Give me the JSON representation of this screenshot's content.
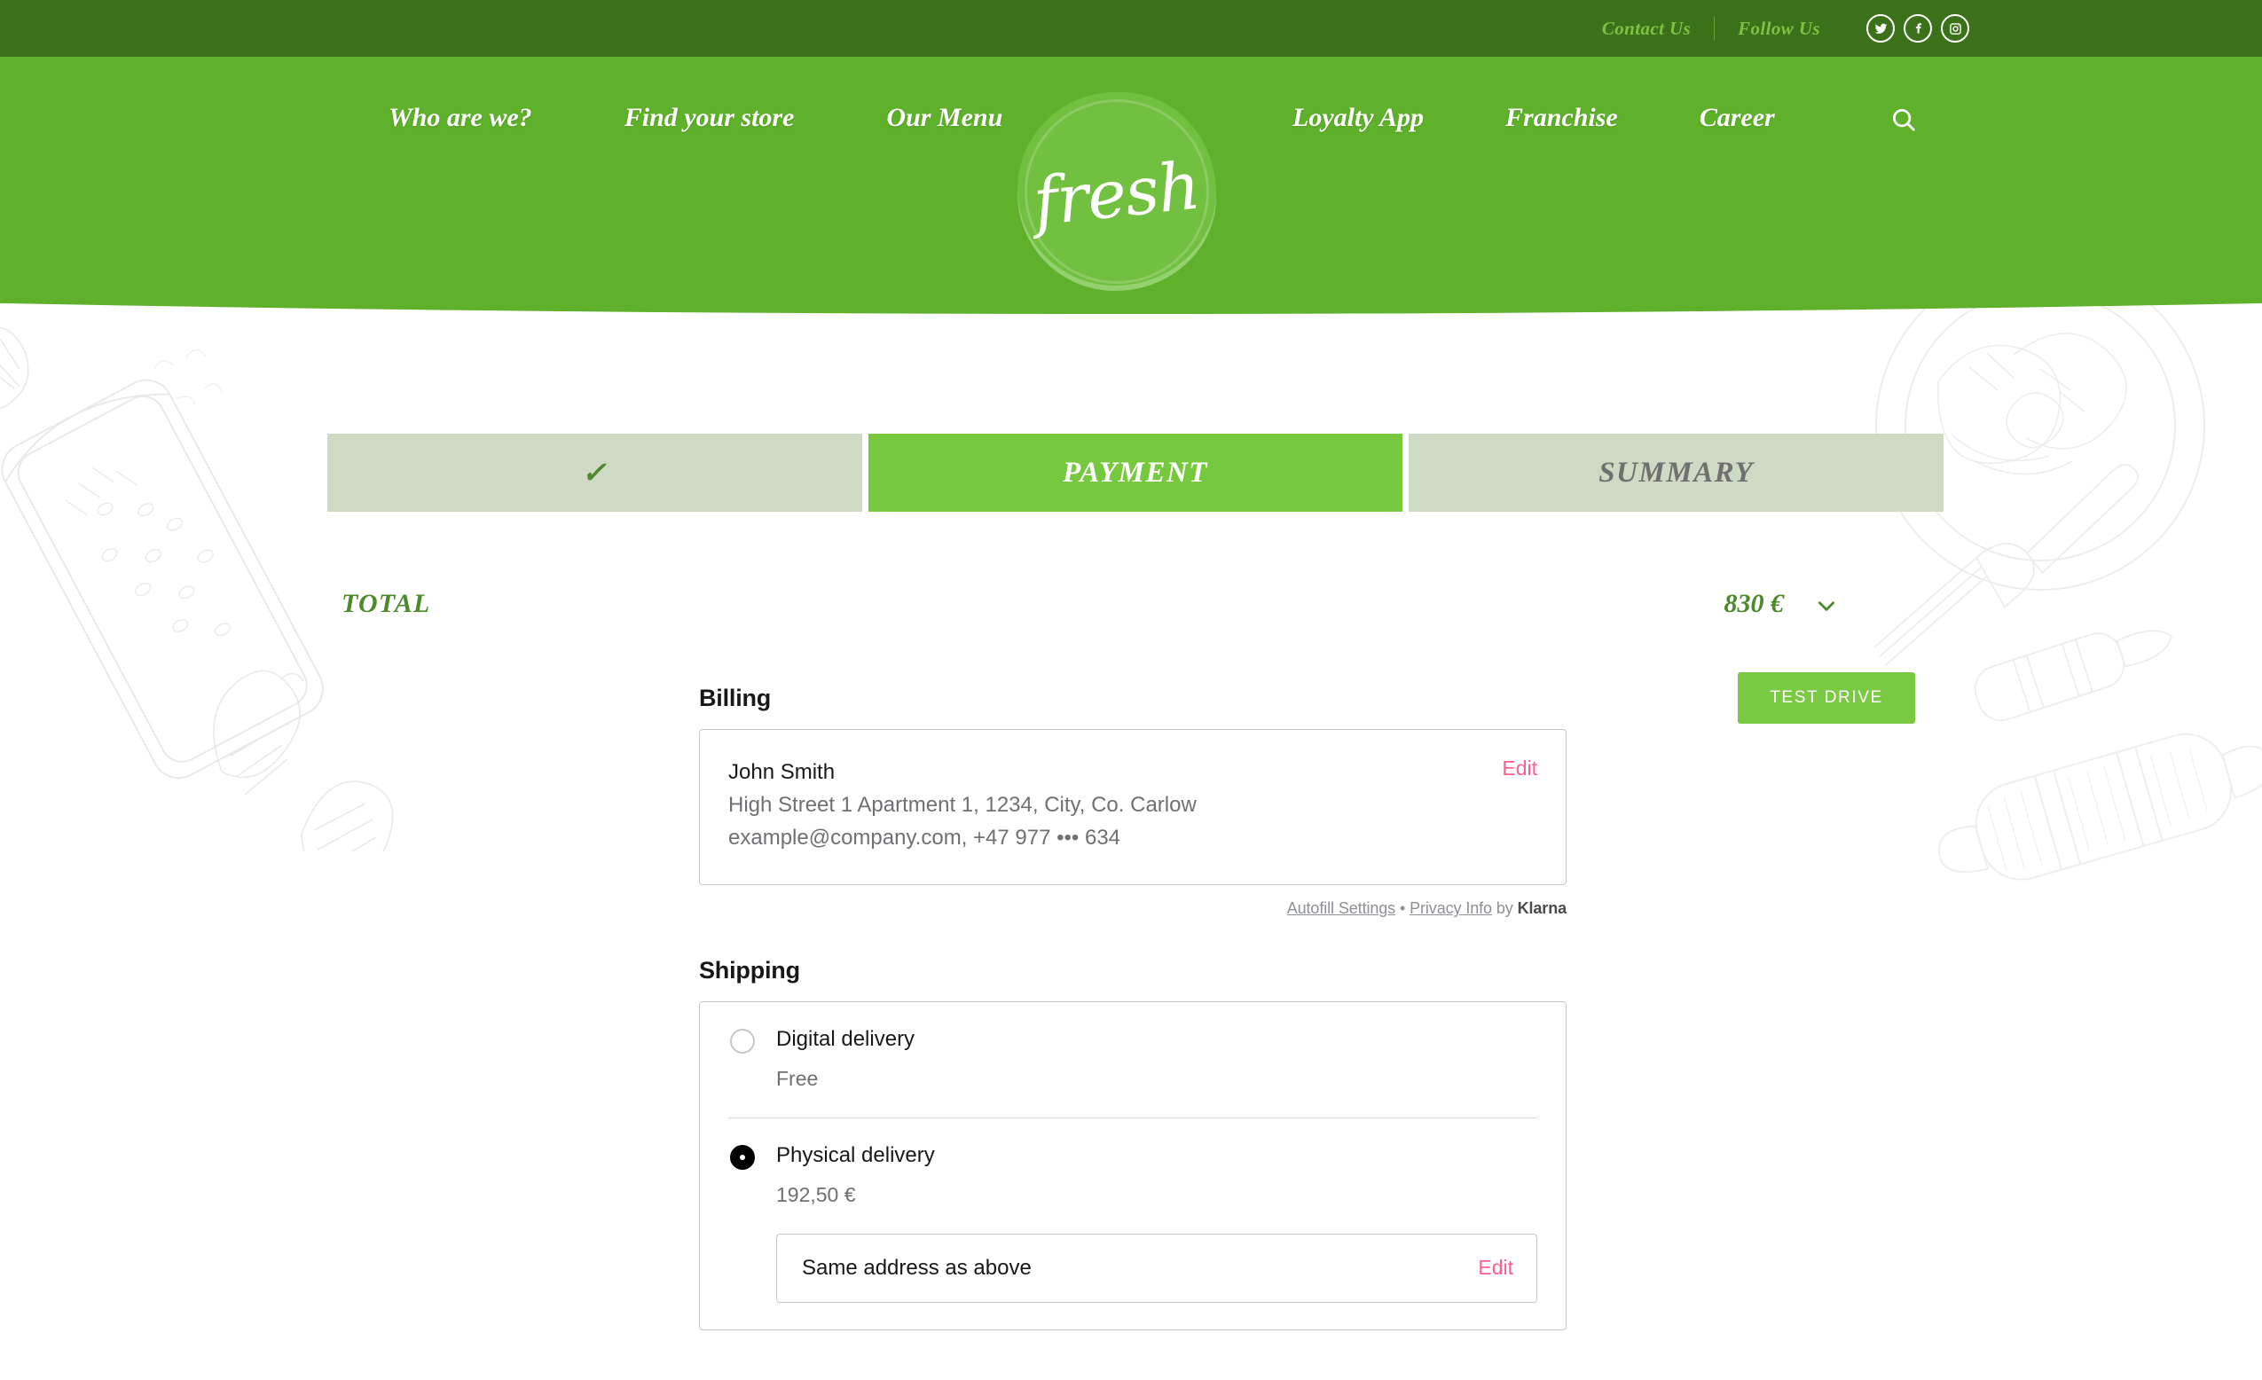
{
  "topbar": {
    "contact_label": "Contact Us",
    "follow_label": "Follow Us",
    "social": [
      {
        "name": "twitter-icon",
        "label": "Twitter"
      },
      {
        "name": "facebook-icon",
        "label": "Facebook"
      },
      {
        "name": "instagram-icon",
        "label": "Instagram"
      }
    ]
  },
  "nav": {
    "left_items": [
      {
        "label": "Who are we?"
      },
      {
        "label": "Find your store"
      },
      {
        "label": "Our Menu"
      }
    ],
    "right_items": [
      {
        "label": "Loyalty App"
      },
      {
        "label": "Franchise"
      },
      {
        "label": "Career"
      }
    ],
    "search_icon": "search-icon"
  },
  "logo": {
    "wordmark": "fresh"
  },
  "steps": [
    {
      "id": "delivery",
      "label": "✓",
      "state": "completed"
    },
    {
      "id": "payment",
      "label": "PAYMENT",
      "state": "active"
    },
    {
      "id": "summary",
      "label": "SUMMARY",
      "state": "upcoming"
    }
  ],
  "total": {
    "label": "TOTAL",
    "amount": "830 €",
    "toggle_icon": "chevron-down-icon"
  },
  "test_drive": {
    "label": "TEST DRIVE"
  },
  "billing": {
    "heading": "Billing",
    "name": "John Smith",
    "address": "High Street 1 Apartment 1, 1234, City, Co. Carlow",
    "contact": "example@company.com, +47 977  ••• 634",
    "edit_label": "Edit"
  },
  "klarna_footer": {
    "autofill_label": "Autofill Settings",
    "separator": "•",
    "privacy_label": "Privacy Info",
    "by_label": "by",
    "brand": "Klarna"
  },
  "shipping": {
    "heading": "Shipping",
    "options": [
      {
        "id": "digital",
        "title": "Digital delivery",
        "price": "Free",
        "selected": false
      },
      {
        "id": "physical",
        "title": "Physical delivery",
        "price": "192,50 €",
        "selected": true
      }
    ],
    "same_address_label": "Same address as above",
    "same_address_edit_label": "Edit"
  },
  "colors": {
    "topbar_green": "#3b7119",
    "nav_green": "#5fb02a",
    "accent_green": "#76c93f",
    "step_inactive": "#cfdac5",
    "total_green": "#4d8a2c",
    "edit_pink": "#ff5f8f",
    "muted_text": "#6e7073"
  }
}
